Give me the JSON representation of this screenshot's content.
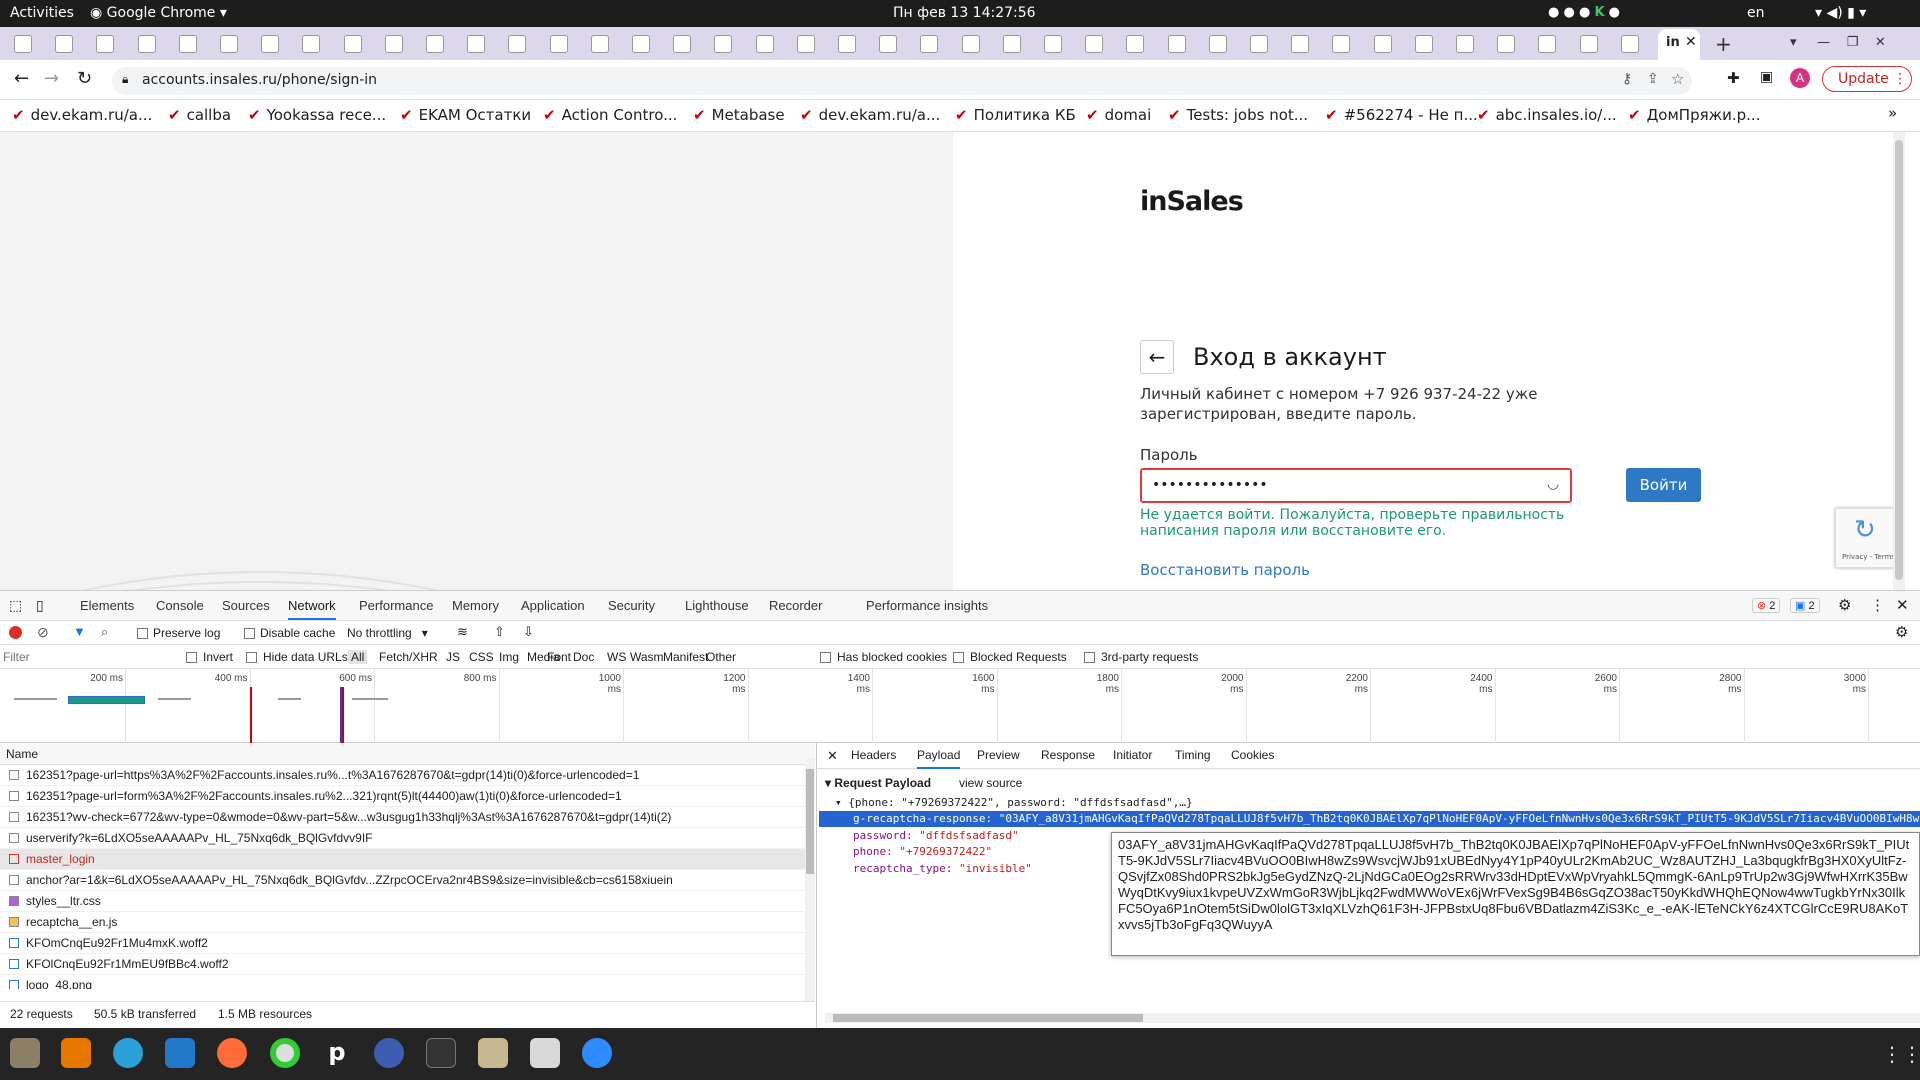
{
  "os": {
    "activities": "Activities",
    "app": "Google Chrome",
    "datetime": "Пн фев 13  14:27:56",
    "lang": "en"
  },
  "browser": {
    "url": "accounts.insales.ru/phone/sign-in",
    "update_label": "Update",
    "avatar": "A",
    "bookmarks": [
      "dev.ekam.ru/a...",
      "callba",
      "Yookassa rece...",
      "EKAM Остатки",
      "Action Contro...",
      "Metabase",
      "dev.ekam.ru/a...",
      "Политика КБ",
      "domai",
      "Tests: jobs not...",
      "#562274 - Не п...",
      "abc.insales.io/...",
      "ДомПряжи.р..."
    ]
  },
  "page": {
    "logo": "inSales",
    "title": "Вход в аккаунт",
    "desc": "Личный кабинет с номером +7 926 937-24-22 уже зарегистрирован, введите пароль.",
    "password_label": "Пароль",
    "password_value": "••••••••••••••",
    "submit": "Войти",
    "error": "Не удается войти. Пожалуйста, проверьте правильность написания пароля или восстановите его.",
    "restore": "Восстановить пароль",
    "recaptcha": "Privacy - Terms"
  },
  "devtools": {
    "tabs": [
      "Elements",
      "Console",
      "Sources",
      "Network",
      "Performance",
      "Memory",
      "Application",
      "Security",
      "Lighthouse",
      "Recorder",
      "Performance insights"
    ],
    "errors": "2",
    "messages": "2",
    "toolbar": {
      "preserve": "Preserve log",
      "disable_cache": "Disable cache",
      "throttling": "No throttling"
    },
    "filter_placeholder": "Filter",
    "filters": [
      "Invert",
      "Hide data URLs",
      "All",
      "Fetch/XHR",
      "JS",
      "CSS",
      "Img",
      "Media",
      "Font",
      "Doc",
      "WS",
      "Wasm",
      "Manifest",
      "Other",
      "Has blocked cookies",
      "Blocked Requests",
      "3rd-party requests"
    ],
    "timeline": [
      "200 ms",
      "400 ms",
      "600 ms",
      "800 ms",
      "1000 ms",
      "1200 ms",
      "1400 ms",
      "1600 ms",
      "1800 ms",
      "2000 ms",
      "2200 ms",
      "2400 ms",
      "2600 ms",
      "2800 ms",
      "3000 ms"
    ],
    "name_header": "Name",
    "requests": [
      "162351?page-url=https%3A%2F%2Faccounts.insales.ru%...t%3A1676287670&t=gdpr(14)ti(0)&force-urlencoded=1",
      "162351?page-url=form%3A%2F%2Faccounts.insales.ru%2...321)rqnt(5)lt(44400)aw(1)ti(0)&force-urlencoded=1",
      "162351?wv-check=6772&wv-type=0&wmode=0&wv-part=5&w...w3usgug1h33hqlj%3Ast%3A1676287670&t=gdpr(14)ti(2)",
      "userverify?k=6LdXO5seAAAAAPv_HL_75Nxq6dk_BQlGvfdvv9IF",
      "master_login",
      "anchor?ar=1&k=6LdXO5seAAAAAPv_HL_75Nxq6dk_BQlGvfdv...ZZrpcOCErva2nr4BS9&size=invisible&cb=cs6158xiuein",
      "styles__ltr.css",
      "recaptcha__en.js",
      "KFOmCnqEu92Fr1Mu4mxK.woff2",
      "KFOlCnqEu92Fr1MmEU9fBBc4.woff2",
      "logo_48.png"
    ],
    "status": {
      "requests": "22 requests",
      "transferred": "50.5 kB transferred",
      "resources": "1.5 MB resources"
    },
    "detail_tabs": [
      "Headers",
      "Payload",
      "Preview",
      "Response",
      "Initiator",
      "Timing",
      "Cookies"
    ],
    "payload": {
      "title": "Request Payload",
      "view_source": "view source",
      "summary": "{phone: \"+79269372422\", password: \"dffdsfsadfasd\",…}",
      "k1": "g-recaptcha-response:",
      "v1": "\"03AFY_a8V31jmAHGvKaqIfPaQVd278TpqaLLUJ8f5vH7b_ThB2tq0K0JBAElXp7qPlNoHEF0ApV-yFFOeLfnNwnHvs0Qe3x6RrS9kT_PIUtT5-9KJdV5SLr7Iiacv4BVuOO0BIwH8w",
      "k2": "password:",
      "v2": "\"dffdsfsadfasd\"",
      "k3": "phone:",
      "v3": "\"+79269372422\"",
      "k4": "recaptcha_type:",
      "v4": "\"invisible\"",
      "tooltip": "03AFY_a8V31jmAHGvKaqIfPaQVd278TpqaLLUJ8f5vH7b_ThB2tq0K0JBAElXp7qPlNoHEF0ApV-yFFOeLfnNwnHvs0Qe3x6RrS9kT_PIUtT5-9KJdV5SLr7Iiacv4BVuOO0BIwH8wZs9WsvcjWJb91xUBEdNyy4Y1pP40yULr2KmAb2UC_Wz8AUTZHJ_La3bqugkfrBg3HX0XyUltFz-QSvjfZx08Shd0PRS2bkJg5eGydZNzQ-2LjNdGCa0EOg2sRRWrv33dHDptEVxWpVryahkL5QmmgK-6AnLp9TrUp2w3Gj9WfwHXrrK35BwWyqDtKvy9iux1kvpeUVZxWmGoR3WjbLjkq2FwdMWWoVEx6jWrFVexSg9B4B6sGqZO38acT50yKkdWHQhEQNow4wwTugkbYrNx30IlkFC5Oya6P1nOtem5tSiDw0lolGT3xIqXLVzhQ61F3H-JFPBstxUq8Fbu6VBDatlazm4ZiS3Kc_e_-eAK-lETeNCkY6z4XTCGlrCcE9RU8AKoTxvvs5jTb3oFgFq3QWuyyA"
    }
  }
}
